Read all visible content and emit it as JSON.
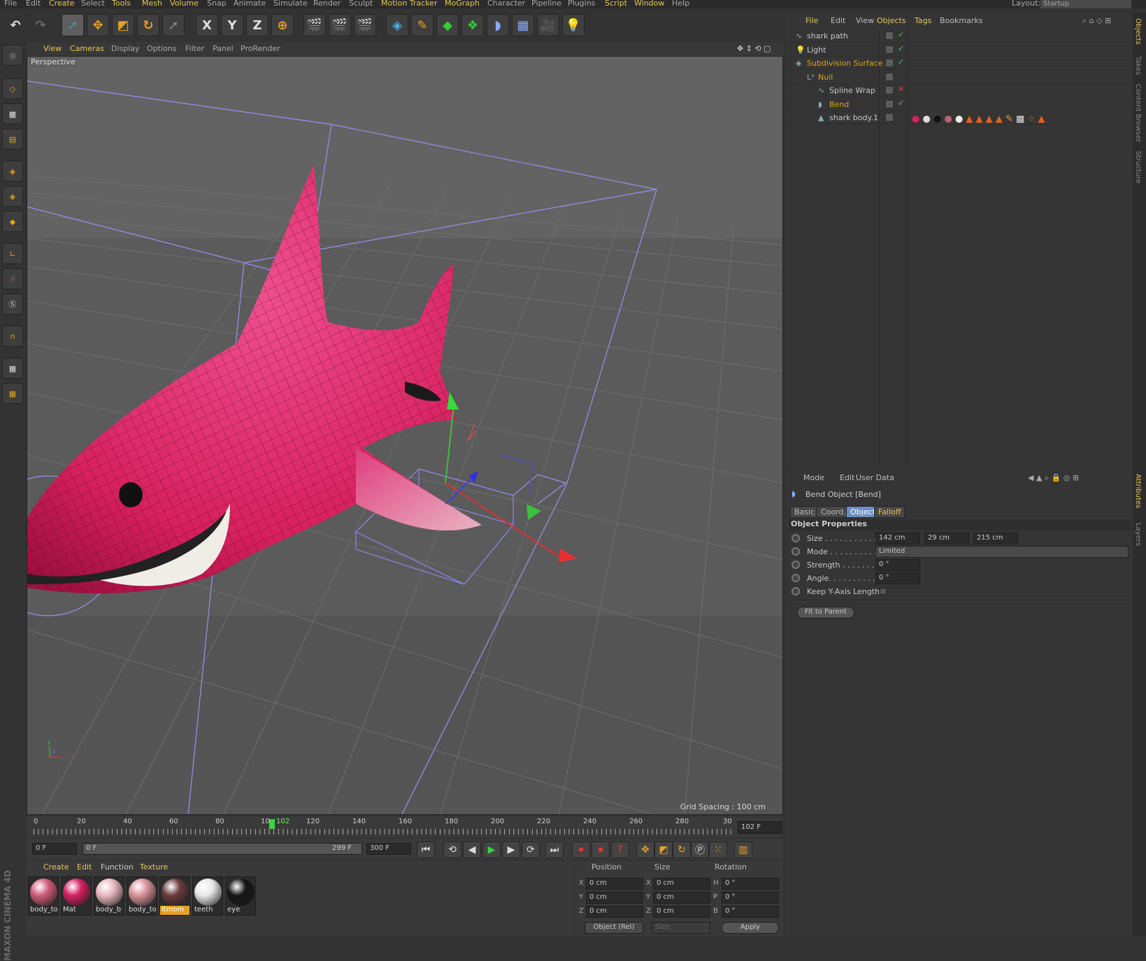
{
  "menubar": {
    "items": [
      "File",
      "Edit",
      "Create",
      "Select",
      "Tools",
      "Mesh",
      "Volume",
      "Snap",
      "Animate",
      "Simulate",
      "Render",
      "Sculpt",
      "Motion Tracker",
      "MoGraph",
      "Character",
      "Pipeline",
      "Plugins",
      "Script",
      "Window",
      "Help"
    ],
    "layout_label": "Layout:",
    "layout_value": "Startup"
  },
  "toolbar": {
    "axis_x": "X",
    "axis_y": "Y",
    "axis_z": "Z"
  },
  "viewport": {
    "menu": [
      "View",
      "Cameras",
      "Display",
      "Options",
      "Filter",
      "Panel",
      "ProRender"
    ],
    "label": "Perspective",
    "grid_spacing": "Grid Spacing : 100 cm"
  },
  "timeline": {
    "ticks": [
      "0",
      "20",
      "40",
      "60",
      "80",
      "10",
      "102",
      "120",
      "140",
      "160",
      "180",
      "200",
      "220",
      "240",
      "260",
      "280",
      "30"
    ],
    "current_frame": "102 F"
  },
  "transport": {
    "start": "0 F",
    "range_start": "0 F",
    "range_end": "299 F",
    "end": "300 F"
  },
  "materials": {
    "menu": [
      "Create",
      "Edit",
      "Function",
      "Texture"
    ],
    "items": [
      {
        "label": "body_to",
        "color": "#d05a7a"
      },
      {
        "label": "Mat",
        "color": "#d42060"
      },
      {
        "label": "body_b",
        "color": "#e8b8c0"
      },
      {
        "label": "body_to",
        "color": "#d89098"
      },
      {
        "label": "itmom",
        "color": "#6a3a3a"
      },
      {
        "label": "teeth",
        "color": "#e8e8e8"
      },
      {
        "label": "eye",
        "color": "#151515"
      }
    ]
  },
  "coords": {
    "headers": [
      "Position",
      "Size",
      "Rotation"
    ],
    "pos": [
      "0 cm",
      "0 cm",
      "0 cm"
    ],
    "size": [
      "0 cm",
      "0 cm",
      "0 cm"
    ],
    "rot": [
      "0 °",
      "0 °",
      "0 °"
    ],
    "pos_axes": [
      "X",
      "Y",
      "Z"
    ],
    "size_axes": [
      "X",
      "Y",
      "Z"
    ],
    "rot_axes": [
      "H",
      "P",
      "B"
    ],
    "mode": "Object (Rel)",
    "size_mode": "Size",
    "apply": "Apply"
  },
  "objects": {
    "menu": [
      "File",
      "Edit",
      "View",
      "Objects",
      "Tags",
      "Bookmarks"
    ],
    "items": [
      {
        "name": "shark path",
        "color": "#c8c8c8",
        "check": "✓",
        "check_color": "#4ec94e"
      },
      {
        "name": "Light",
        "color": "#c8c8c8",
        "check": "✓",
        "check_color": "#4ec94e"
      },
      {
        "name": "Subdivision Surface",
        "color": "#e0a020",
        "check": "✓",
        "check_color": "#4ec94e"
      },
      {
        "name": "Null",
        "color": "#e0a020",
        "check": "",
        "check_color": "#4ec94e"
      },
      {
        "name": "Spline Wrap",
        "color": "#c8c8c8",
        "check": "✕",
        "check_color": "#e04040"
      },
      {
        "name": "Bend",
        "color": "#e0a020",
        "check": "✓",
        "check_color": "#4ec94e"
      },
      {
        "name": "shark body.1",
        "color": "#c8c8c8",
        "check": "",
        "check_color": "#4ec94e"
      }
    ]
  },
  "attributes": {
    "menu": [
      "Mode",
      "Edit",
      "User Data"
    ],
    "title": "Bend Object [Bend]",
    "tabs": [
      "Basic",
      "Coord.",
      "Object",
      "Falloff"
    ],
    "section": "Object Properties",
    "size_label": "Size . . . . . . . . . . . .",
    "size_values": [
      "142 cm",
      "29 cm",
      "215 cm"
    ],
    "mode_label": "Mode . . . . . . . . . . .",
    "mode_value": "Limited",
    "strength_label": "Strength . . . . . . . .",
    "strength_value": "0 °",
    "angle_label": "Angle. . . . . . . . . . .",
    "angle_value": "0 °",
    "keep_label": "Keep Y-Axis Length",
    "fit_button": "Fit to Parent"
  },
  "side_tabs": [
    "Objects",
    "Takes",
    "Content Browser",
    "Structure",
    "Attributes",
    "Layers"
  ],
  "branding": "MAXON CINEMA 4D"
}
